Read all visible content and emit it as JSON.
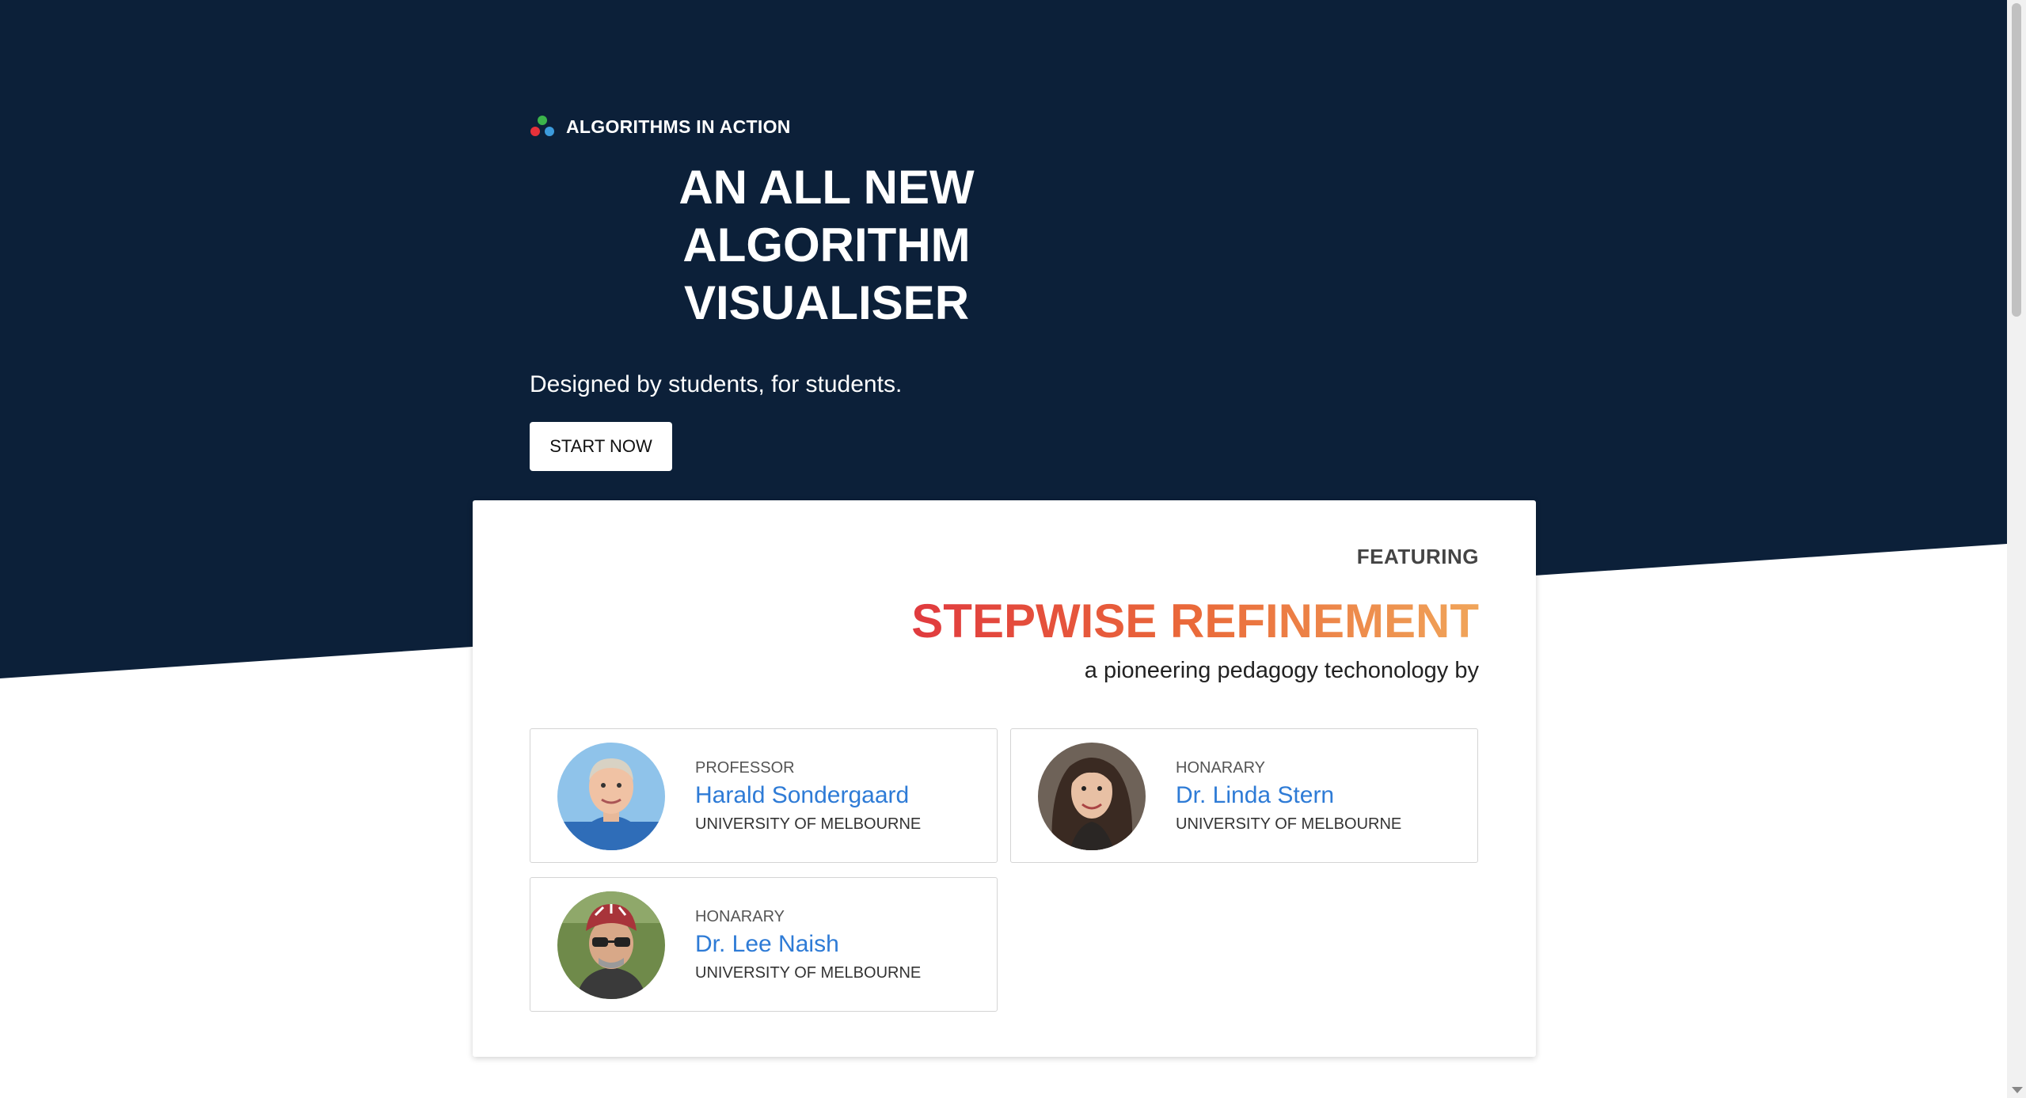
{
  "colors": {
    "hero_background": "#0c2039",
    "accent_blue": "#2e7bd6",
    "gradient_start": "#e03a3e",
    "gradient_end": "#f0a55a"
  },
  "brand": {
    "logo_icon": "three-dots-logo-icon",
    "name": "ALGORITHMS IN ACTION"
  },
  "hero": {
    "title_line1": "AN ALL NEW ALGORITHM",
    "title_line2": "VISUALISER",
    "subtitle": "Designed by students, for students.",
    "cta_label": "START NOW"
  },
  "featured": {
    "label": "FEATURING",
    "title": "STEPWISE REFINEMENT",
    "subtitle": "a pioneering pedagogy techonology by",
    "people": [
      {
        "role": "PROFESSOR",
        "name": "Harald Sondergaard",
        "affiliation": "UNIVERSITY OF MELBOURNE",
        "avatar_icon": "photo-harald-sondergaard"
      },
      {
        "role": "HONARARY",
        "name": "Dr. Linda Stern",
        "affiliation": "UNIVERSITY OF MELBOURNE",
        "avatar_icon": "photo-linda-stern"
      },
      {
        "role": "HONARARY",
        "name": "Dr. Lee Naish",
        "affiliation": "UNIVERSITY OF MELBOURNE",
        "avatar_icon": "photo-lee-naish"
      }
    ]
  }
}
